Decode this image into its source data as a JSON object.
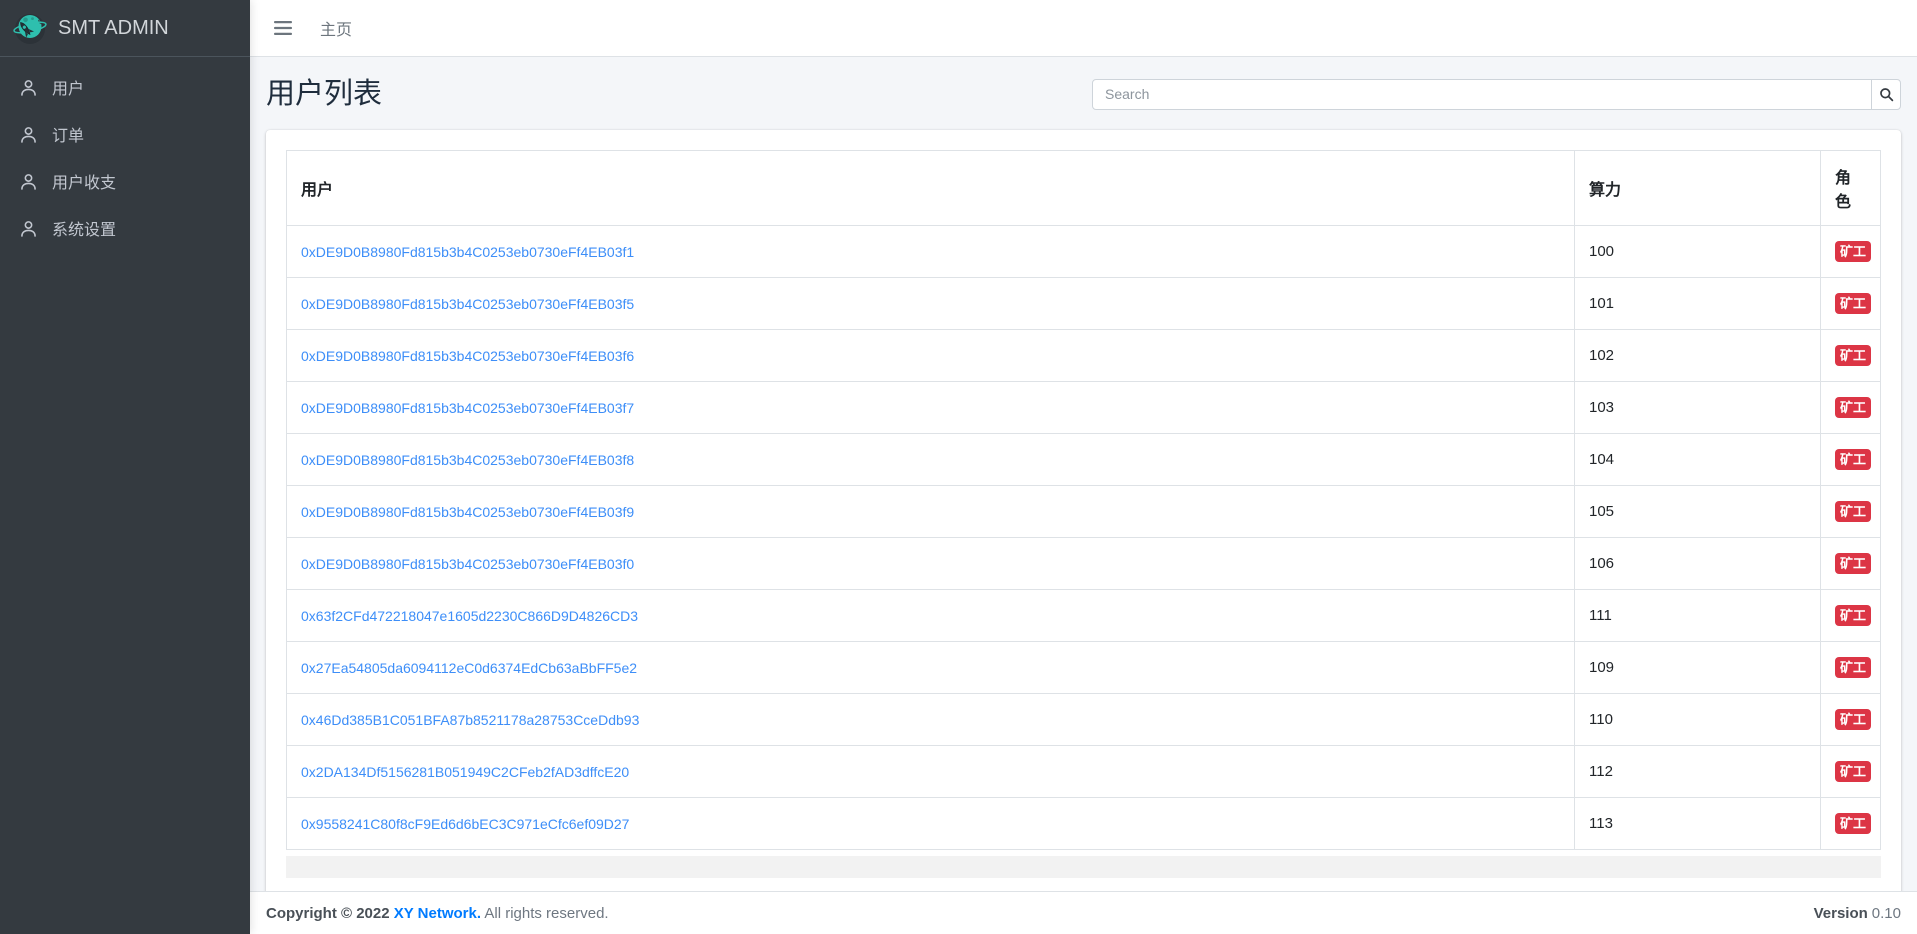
{
  "brand": {
    "title": "SMT ADMIN"
  },
  "sidebar": {
    "items": [
      {
        "label": "用户"
      },
      {
        "label": "订单"
      },
      {
        "label": "用户收支"
      },
      {
        "label": "系统设置"
      }
    ]
  },
  "topbar": {
    "home_label": "主页"
  },
  "page": {
    "title": "用户列表"
  },
  "search": {
    "placeholder": "Search"
  },
  "table": {
    "columns": {
      "user": "用户",
      "power": "算力",
      "role": "角色"
    },
    "rows": [
      {
        "address": "0xDE9D0B8980Fd815b3b4C0253eb0730eFf4EB03f1",
        "power": "100",
        "role": "矿工"
      },
      {
        "address": "0xDE9D0B8980Fd815b3b4C0253eb0730eFf4EB03f5",
        "power": "101",
        "role": "矿工"
      },
      {
        "address": "0xDE9D0B8980Fd815b3b4C0253eb0730eFf4EB03f6",
        "power": "102",
        "role": "矿工"
      },
      {
        "address": "0xDE9D0B8980Fd815b3b4C0253eb0730eFf4EB03f7",
        "power": "103",
        "role": "矿工"
      },
      {
        "address": "0xDE9D0B8980Fd815b3b4C0253eb0730eFf4EB03f8",
        "power": "104",
        "role": "矿工"
      },
      {
        "address": "0xDE9D0B8980Fd815b3b4C0253eb0730eFf4EB03f9",
        "power": "105",
        "role": "矿工"
      },
      {
        "address": "0xDE9D0B8980Fd815b3b4C0253eb0730eFf4EB03f0",
        "power": "106",
        "role": "矿工"
      },
      {
        "address": "0x63f2CFd472218047e1605d2230C866D9D4826CD3",
        "power": "111",
        "role": "矿工"
      },
      {
        "address": "0x27Ea54805da6094112eC0d6374EdCb63aBbFF5e2",
        "power": "109",
        "role": "矿工"
      },
      {
        "address": "0x46Dd385B1C051BFA87b8521178a28753CceDdb93",
        "power": "110",
        "role": "矿工"
      },
      {
        "address": "0x2DA134Df5156281B051949C2CFeb2fAD3dffcE20",
        "power": "112",
        "role": "矿工"
      },
      {
        "address": "0x9558241C80f8cF9Ed6d6bEC3C971eCfc6ef09D27",
        "power": "113",
        "role": "矿工"
      }
    ]
  },
  "footer": {
    "copyright_prefix": "Copyright © 2022",
    "company": "XY Network.",
    "rights": "All rights reserved.",
    "version_label": "Version",
    "version_value": "0.10"
  },
  "colors": {
    "sidebar_bg": "#343a40",
    "brand_teal": "#2ebfae",
    "link_blue": "#3d8ef8",
    "badge_danger": "#dc3545",
    "content_bg": "#f4f6f9"
  }
}
